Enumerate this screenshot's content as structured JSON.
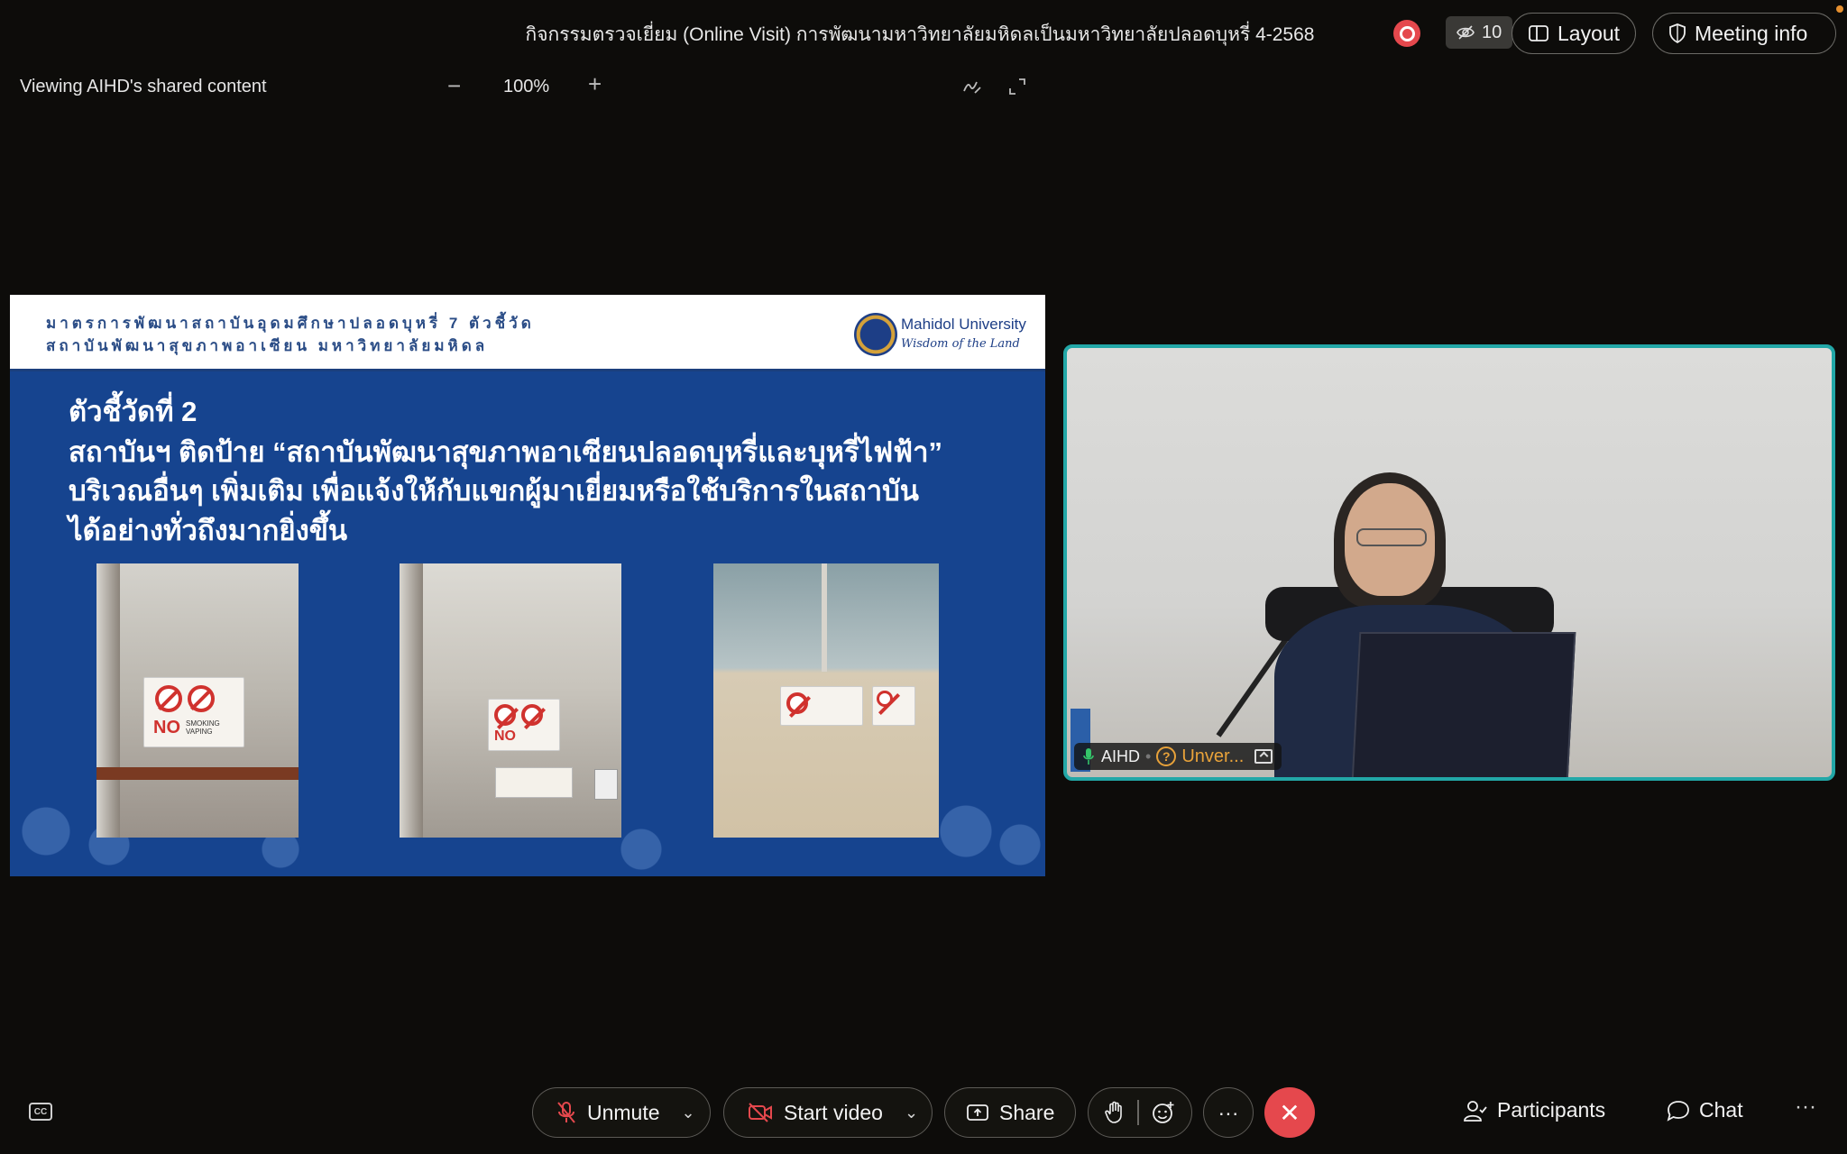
{
  "header": {
    "meeting_title": "กิจกรรมตรวจเยี่ยม (Online Visit) การพัฒนามหาวิทยาลัยมหิดลเป็นมหาวิทยาลัยปลอดบุหรี่ 4-2568",
    "hidden_participants_count": "10",
    "layout_label": "Layout",
    "meeting_info_label": "Meeting info"
  },
  "share_bar": {
    "viewing_label": "Viewing AIHD's shared content",
    "zoom_minus": "−",
    "zoom_level": "100%",
    "zoom_plus": "+"
  },
  "slide": {
    "header_line_1": "มาตรการพัฒนาสถาบันอุดมศึกษาปลอดบุหรี่ 7 ตัวชี้วัด",
    "header_line_2": "สถาบันพัฒนาสุขภาพอาเซียน มหาวิทยาลัยมหิดล",
    "university_name": "Mahidol University",
    "university_tagline": "Wisdom of the Land",
    "indicator_title": "ตัวชี้วัดที่ 2",
    "body_line_1": "สถาบันฯ ติดป้าย “สถาบันพัฒนาสุขภาพอาเซียนปลอดบุหรี่และบุหรี่ไฟฟ้า”",
    "body_line_2": "บริเวณอื่นๆ เพิ่มเติม เพื่อแจ้งให้กับแขกผู้มาเยี่ยมหรือใช้บริการในสถาบัน",
    "body_line_3": "ได้อย่างทั่วถึงมากยิ่งขึ้น",
    "sign_no_text": "NO",
    "sign_smoking_text": "SMOKING VAPING"
  },
  "video_tile": {
    "participant_name": "AIHD",
    "verification_status": "Unver...",
    "accent_color": "#22a7a7"
  },
  "controls": {
    "cc_label": "CC",
    "unmute_label": "Unmute",
    "start_video_label": "Start video",
    "share_label": "Share",
    "more_label": "···",
    "leave_label": "✕",
    "participants_label": "Participants",
    "chat_label": "Chat",
    "overflow_label": "···"
  },
  "colors": {
    "background": "#0d0c0a",
    "record_red": "#e5484d",
    "slide_blue": "#16448f",
    "warning_orange": "#e8a23a"
  }
}
